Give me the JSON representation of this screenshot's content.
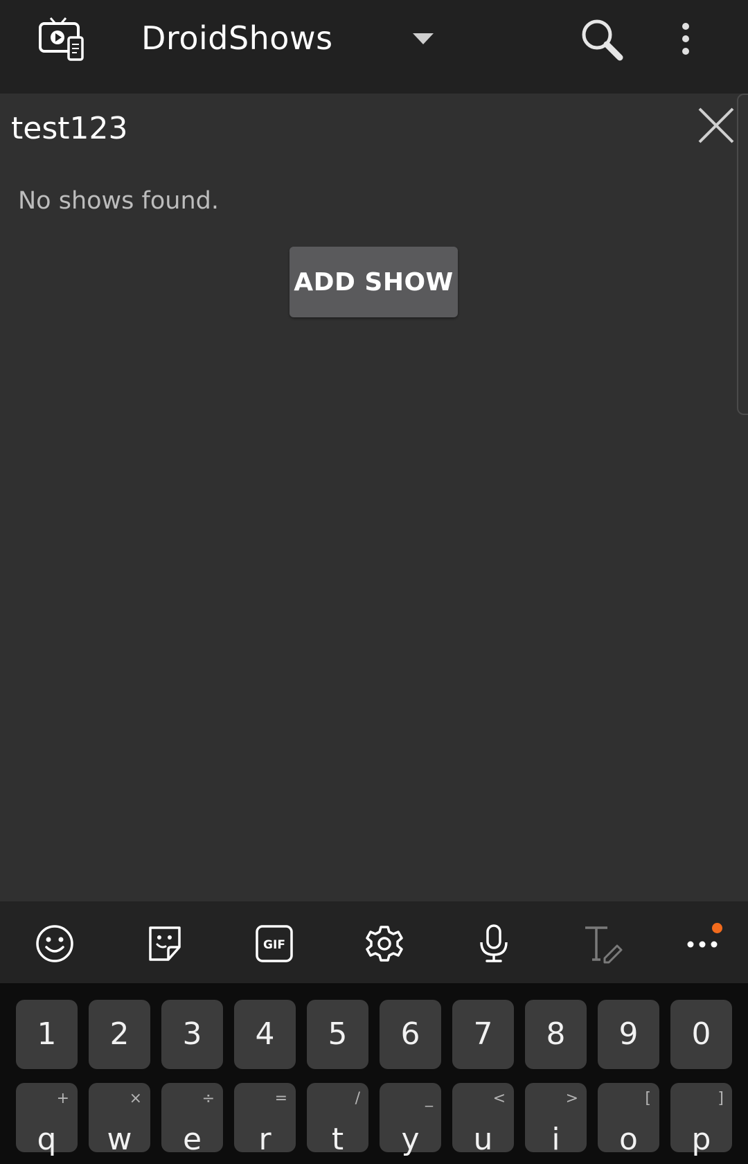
{
  "app_bar": {
    "app_icon": "tv-remote-app-icon",
    "title": "DroidShows",
    "dropdown_icon": "triangle-down-icon",
    "search_icon": "search-icon",
    "overflow_icon": "more-vert-icon"
  },
  "search": {
    "query": "test123",
    "clear_icon": "close-icon"
  },
  "content": {
    "empty_message": "No shows found.",
    "add_show_label": "ADD SHOW"
  },
  "keyboard_toolbar": {
    "icons": [
      "emoji-icon",
      "sticker-icon",
      "gif-icon",
      "settings-icon",
      "microphone-icon",
      "text-edit-icon",
      "more-horiz-icon"
    ],
    "notification_color": "#f26b1d"
  },
  "keyboard": {
    "number_row": [
      "1",
      "2",
      "3",
      "4",
      "5",
      "6",
      "7",
      "8",
      "9",
      "0"
    ],
    "letter_row": [
      {
        "key": "q",
        "alt": "+"
      },
      {
        "key": "w",
        "alt": "×"
      },
      {
        "key": "e",
        "alt": "÷"
      },
      {
        "key": "r",
        "alt": "="
      },
      {
        "key": "t",
        "alt": "/"
      },
      {
        "key": "y",
        "alt": "_"
      },
      {
        "key": "u",
        "alt": "<"
      },
      {
        "key": "i",
        "alt": ">"
      },
      {
        "key": "o",
        "alt": "["
      },
      {
        "key": "p",
        "alt": "]"
      }
    ]
  },
  "colors": {
    "app_bar_bg": "#212121",
    "content_bg": "#303030",
    "button_bg": "#5a5a5c",
    "keyboard_bg": "#0d0d0d",
    "key_bg": "#3c3c3c"
  }
}
